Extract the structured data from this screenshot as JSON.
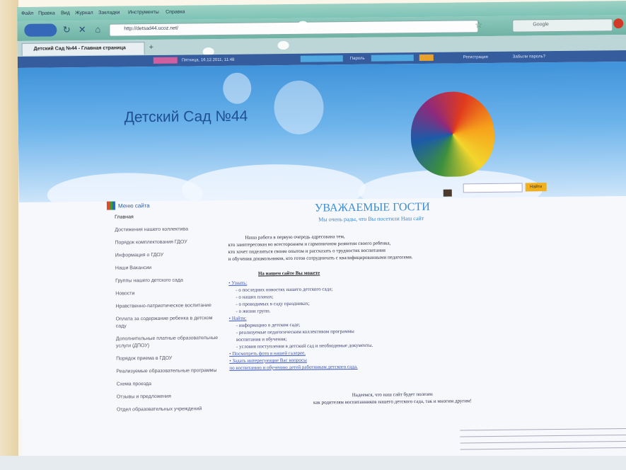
{
  "browser": {
    "menu": [
      "Файл",
      "Правка",
      "Вид",
      "Журнал",
      "Закладки",
      "Инструменты",
      "Справка"
    ],
    "url": "http://detsad44.ucoz.net/",
    "search_placeholder": "Google",
    "tab_title": "Детский Сад №44 - Главная страница",
    "tab_new": "+"
  },
  "topbar": {
    "datetime": "Пятница, 16.12.2011, 11:48",
    "login_label": "Логин",
    "password_label": "Пароль",
    "login_button": "Вход",
    "register_link": "Регистрация",
    "remind_link": "Забыли пароль?"
  },
  "site": {
    "title": "Детский Сад №44",
    "search_button": "Найти"
  },
  "sidebar": {
    "title": "Меню сайта",
    "items": [
      "Главная",
      "Достижения нашего коллектива",
      "Порядок комплектования ГДОУ",
      "Информация о ГДОУ",
      "Наши Вакансии",
      "Группы нашего детского сада",
      "Новости",
      "Нравственно-патриотическое воспитание",
      "Оплата за содержание ребенка в детском саду",
      "Дополнительные платные образовательные услуги (ДПОУ)",
      "Порядок приема в ГДОУ",
      "Реализуемые образовательные программы",
      "Схема проезда",
      "Отзывы и предложения",
      "Отдел образовательных учреждений"
    ]
  },
  "main": {
    "heading": "УВАЖАЕМЫЕ ГОСТИ",
    "subheading": "Мы очень рады, что Вы посетили Наш сайт",
    "intro": [
      "Наша работа в первую очередь адресована тем,",
      "кто заинтересован во всестороннем и гармоничном развитии своего ребенка,",
      "кто хочет поделиться своим опытом и рассказать о трудностях воспитания",
      "и обучения дошкольников, кто готов сотрудничать с квалифицированными педагогами."
    ],
    "can_heading": "На нашем сайте Вы можете",
    "features": [
      {
        "text": "• Узнать:",
        "style": "b"
      },
      {
        "text": "- о последних новостях нашего детского сада;",
        "style": "s"
      },
      {
        "text": "- о наших планах;",
        "style": "s"
      },
      {
        "text": "- о проводимых в саду праздниках;",
        "style": "s"
      },
      {
        "text": "- о жизни групп.",
        "style": "s"
      },
      {
        "text": "• Найти:",
        "style": "b"
      },
      {
        "text": "- информацию о детском саде;",
        "style": "s"
      },
      {
        "text": "- реализуемые педагогическим коллективом программы",
        "style": "s"
      },
      {
        "text": "воспитания и обучения;",
        "style": "s"
      },
      {
        "text": "- условия поступления в детский сад и необходимые документы.",
        "style": "s"
      },
      {
        "text": "• Посмотреть фото в нашей галерее.",
        "style": "b"
      },
      {
        "text": "• Задать интересующие Вас вопросы",
        "style": "b"
      },
      {
        "text": "по воспитанию и обучению детей работникам детского сада.",
        "style": "b"
      }
    ],
    "closing": [
      "Надеемся, что наш сайт будет полезен",
      "как родителям воспитанников нашего детского сада, так и многим другим!"
    ]
  },
  "colors": {
    "header_blue": "#3f93da",
    "title_blue": "#1f4f93",
    "accent_orange": "#f0b020"
  }
}
